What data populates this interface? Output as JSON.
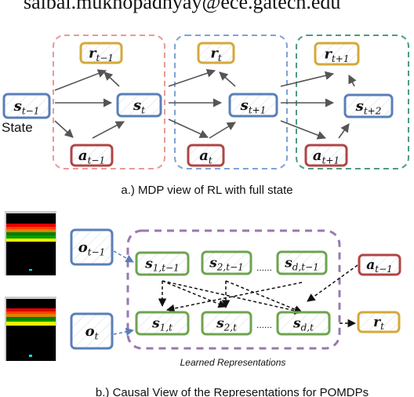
{
  "header": {
    "email_text": "saibal.mukhopadhyay@ece.gatech.edu"
  },
  "colors": {
    "state": "#5a7fb8",
    "reward": "#d4a93a",
    "action": "#b04545",
    "latent": "#6ea44e",
    "group_pink": "#e89a9a",
    "group_blue": "#7fa2d8",
    "group_green": "#4e9a83",
    "group_purple": "#9a78b0",
    "arrow": "#555555"
  },
  "panel_a": {
    "state_label": "State",
    "caption": "a.) MDP view of RL with full state",
    "nodes": {
      "s_prev": {
        "base": "s",
        "sub": "t−1"
      },
      "s_t": {
        "base": "s",
        "sub": "t"
      },
      "s_t1": {
        "base": "s",
        "sub": "t+1"
      },
      "s_t2": {
        "base": "s",
        "sub": "t+2"
      },
      "r_prev": {
        "base": "r",
        "sub": "t−1"
      },
      "r_t": {
        "base": "r",
        "sub": "t"
      },
      "r_t1": {
        "base": "r",
        "sub": "t+1"
      },
      "a_prev": {
        "base": "a",
        "sub": "t−1"
      },
      "a_t": {
        "base": "a",
        "sub": "t"
      },
      "a_t1": {
        "base": "a",
        "sub": "t+1"
      }
    }
  },
  "panel_b": {
    "caption": "b.) Causal View of the Representations for POMDPs",
    "group_label": "Learned Representations",
    "ellipsis": "......",
    "nodes": {
      "o_prev": {
        "base": "o",
        "sub": "t−1"
      },
      "o_t": {
        "base": "o",
        "sub": "t"
      },
      "s1_prev": {
        "base": "s",
        "sub": "1,t−1"
      },
      "s2_prev": {
        "base": "s",
        "sub": "2,t−1"
      },
      "sd_prev": {
        "base": "s",
        "sub": "d,t−1"
      },
      "s1_t": {
        "base": "s",
        "sub": "1,t"
      },
      "s2_t": {
        "base": "s",
        "sub": "2,t"
      },
      "sd_t": {
        "base": "s",
        "sub": "d,t"
      },
      "a_prev": {
        "base": "a",
        "sub": "t−1"
      },
      "r_t": {
        "base": "r",
        "sub": "t"
      }
    },
    "frames": [
      "atari-frame-t-minus-1",
      "atari-frame-t"
    ]
  }
}
